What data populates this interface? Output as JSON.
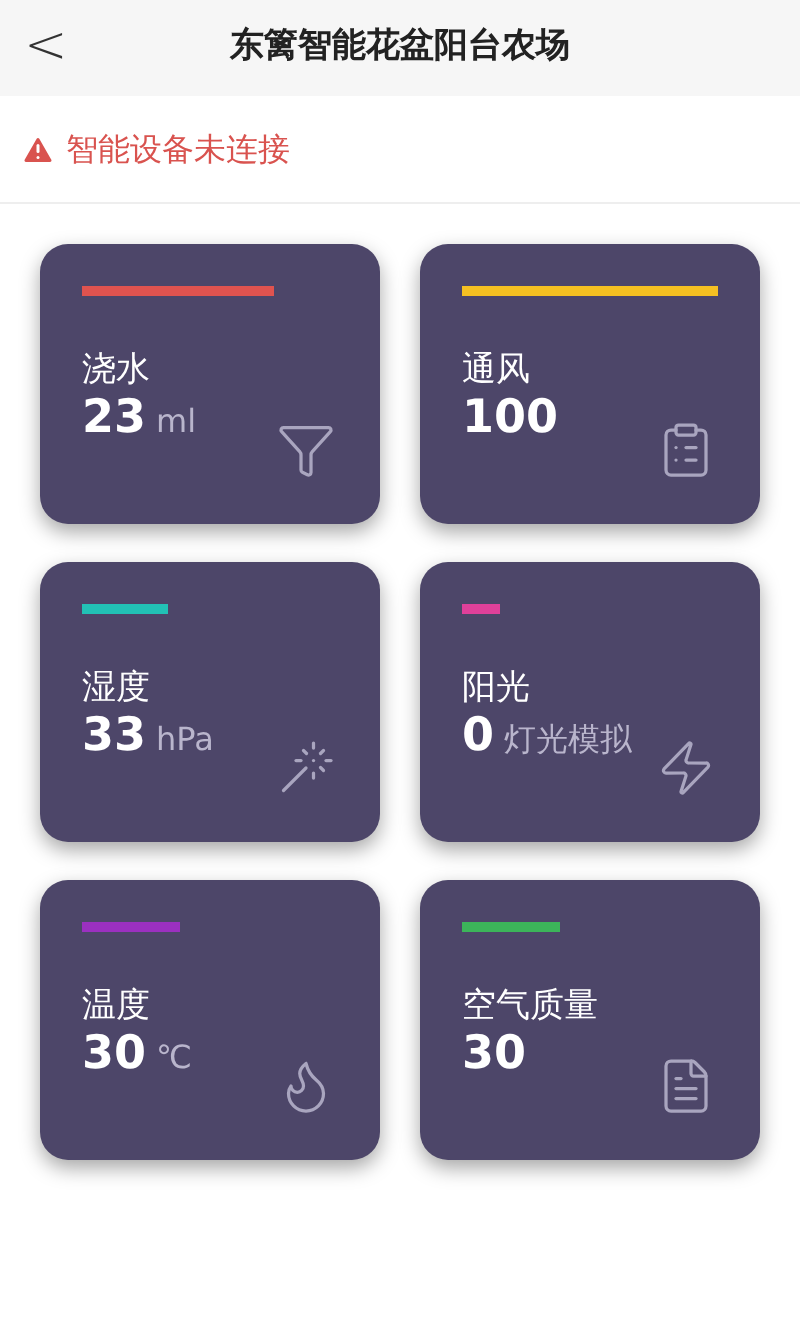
{
  "header": {
    "back": "<",
    "title": "东篱智能花盆阳台农场"
  },
  "alert": {
    "text": "智能设备未连接"
  },
  "cards": [
    {
      "label": "浇水",
      "value": "23",
      "unit": "ml",
      "color": "#e0534f"
    },
    {
      "label": "通风",
      "value": "100",
      "color": "#f5c022"
    },
    {
      "label": "湿度",
      "value": "33",
      "unit": "hPa",
      "color": "#22c1b5"
    },
    {
      "label": "阳光",
      "value": "0",
      "unit": "灯光模拟",
      "color": "#e0409a"
    },
    {
      "label": "温度",
      "value": "30",
      "unit": "℃",
      "color": "#9b30c0"
    },
    {
      "label": "空气质量",
      "value": "30",
      "color": "#3cb55a"
    }
  ]
}
